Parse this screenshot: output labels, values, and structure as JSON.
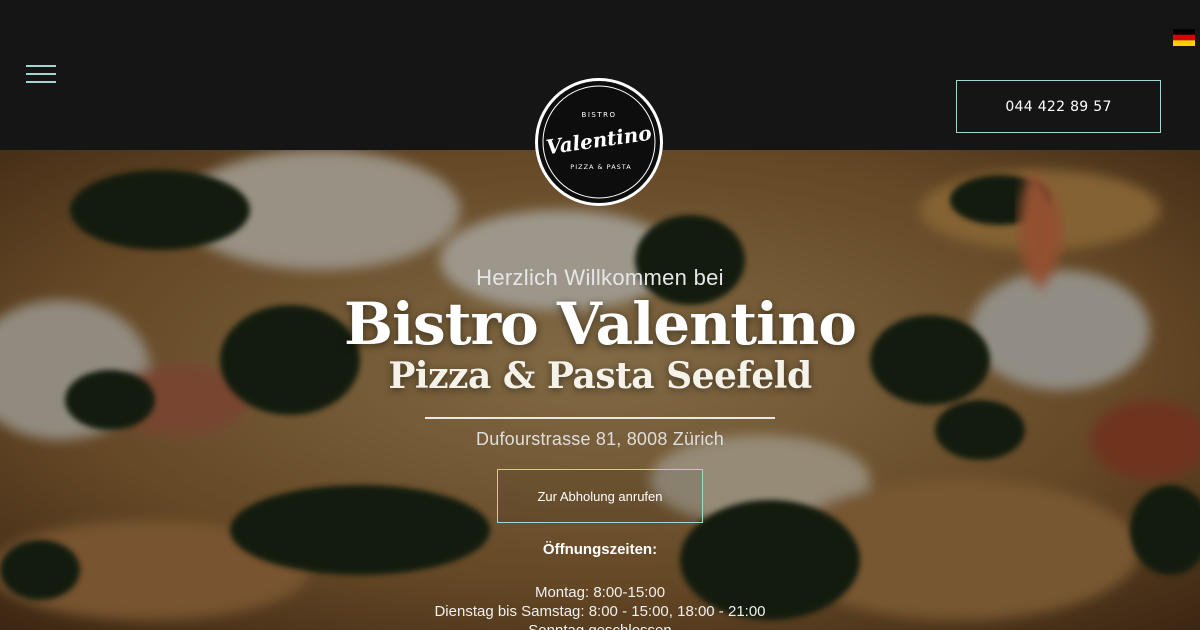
{
  "header": {
    "menu_icon": "hamburger-menu-icon",
    "language_icon": "german-flag-icon",
    "phone_label": "044 422 89 57"
  },
  "logo": {
    "top": "BISTRO",
    "name": "Valentino",
    "bottom": "PIZZA & PASTA"
  },
  "hero": {
    "welcome": "Herzlich Willkommen bei",
    "title": "Bistro Valentino",
    "subtitle": "Pizza & Pasta Seefeld",
    "address": "Dufourstrasse 81, 8008 Zürich",
    "pickup_label": "Zur Abholung anrufen",
    "hours_title": "Öffnungszeiten:",
    "hours": [
      "Montag: 8:00-15:00",
      "Dienstag bis Samstag: 8:00 - 15:00, 18:00 - 21:00",
      "Sonntag geschlossen"
    ]
  },
  "colors": {
    "header_bg": "#151515",
    "accent": "#9fd8cf",
    "text": "#ffffff"
  }
}
